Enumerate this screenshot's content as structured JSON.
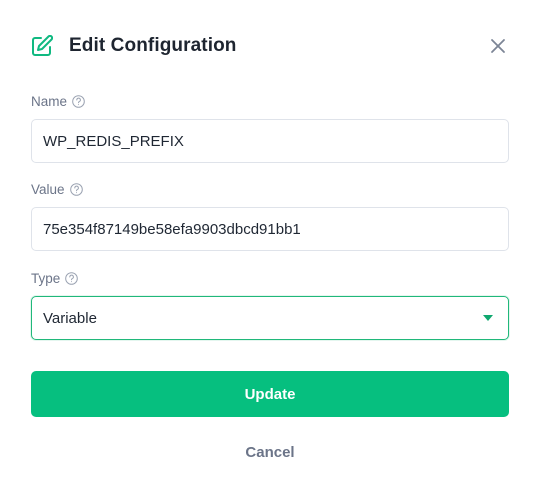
{
  "dialog": {
    "title": "Edit Configuration",
    "icons": {
      "title_icon": "edit-icon",
      "close_icon": "close-icon",
      "help_icon": "help-circle-icon"
    }
  },
  "fields": {
    "name": {
      "label": "Name",
      "value": "WP_REDIS_PREFIX"
    },
    "value": {
      "label": "Value",
      "value": "75e354f87149be58efa9903dbcd91bb1"
    },
    "type": {
      "label": "Type",
      "selected": "Variable"
    }
  },
  "actions": {
    "update_label": "Update",
    "cancel_label": "Cancel"
  },
  "colors": {
    "accent": "#06bf7f",
    "focus_border": "#20b87a",
    "label": "#6b7488"
  }
}
